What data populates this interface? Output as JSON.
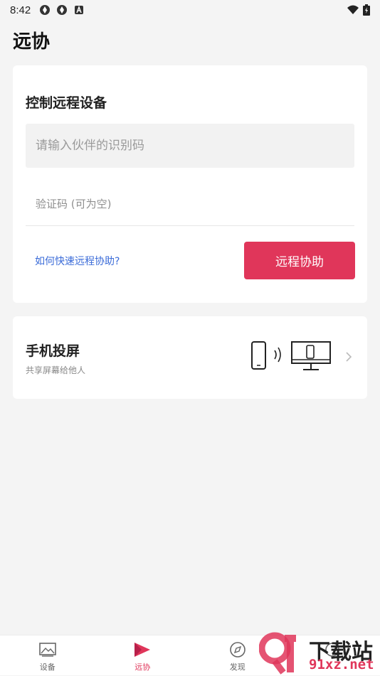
{
  "status_bar": {
    "time": "8:42",
    "icons": [
      "sync-icon",
      "sync-icon",
      "a-icon",
      "wifi-icon",
      "battery-icon"
    ]
  },
  "page": {
    "title": "远协"
  },
  "remote_card": {
    "title": "控制远程设备",
    "id_placeholder": "请输入伙伴的识别码",
    "id_value": "",
    "code_placeholder": "验证码 (可为空)",
    "code_value": "",
    "help_link": "如何快速远程协助?",
    "action_button": "远程协助"
  },
  "cast_card": {
    "title": "手机投屏",
    "subtitle": "共享屏幕给他人",
    "illustration": "phone-to-monitor-icon"
  },
  "tabbar": {
    "active": "远协",
    "tabs": [
      {
        "label": "设备",
        "icon": "image-frame-icon"
      },
      {
        "label": "远协",
        "icon": "remote-flag-icon"
      },
      {
        "label": "发现",
        "icon": "compass-icon"
      },
      {
        "label": "",
        "icon": "profile-icon"
      }
    ]
  },
  "watermark": {
    "logo_text": "9f",
    "title": "下载站",
    "domain": "91xz.net"
  },
  "colors": {
    "accent": "#e0365a",
    "link": "#3a6bd8",
    "background": "#f4f4f4"
  }
}
